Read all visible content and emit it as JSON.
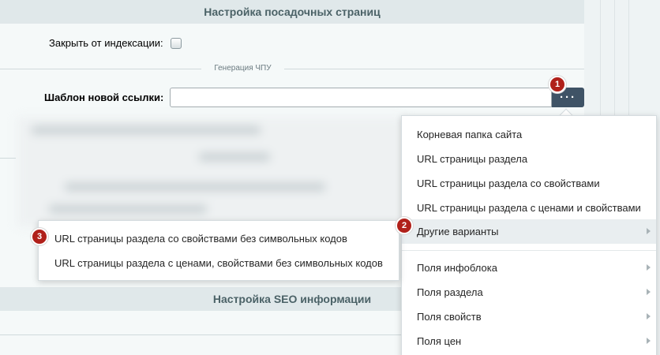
{
  "landing_section": {
    "title": "Настройка посадочных страниц",
    "noindex_label": "Закрыть от индексации:",
    "noindex_checked": false,
    "slug_group_label": "Генерация ЧПУ",
    "template_label": "Шаблон новой ссылки:",
    "template_value": "",
    "template_placeholder": "",
    "menu_button_label": "···"
  },
  "seo_section": {
    "title": "Настройка SEO информации"
  },
  "badges": [
    "1",
    "2",
    "3"
  ],
  "dropdown_menu": {
    "items": [
      {
        "label": "Корневая папка сайта",
        "has_submenu": false
      },
      {
        "label": "URL страницы раздела",
        "has_submenu": false
      },
      {
        "label": "URL страницы раздела со свойствами",
        "has_submenu": false
      },
      {
        "label": "URL страницы раздела с ценами и свойствами",
        "has_submenu": false
      },
      {
        "label": "Другие варианты",
        "has_submenu": true,
        "highlighted": true
      },
      {
        "label": "Поля инфоблока",
        "has_submenu": true
      },
      {
        "label": "Поля раздела",
        "has_submenu": true
      },
      {
        "label": "Поля свойств",
        "has_submenu": true
      },
      {
        "label": "Поля цен",
        "has_submenu": true
      }
    ]
  },
  "submenu": {
    "items": [
      {
        "label": "URL страницы раздела со свойствами без символьных кодов"
      },
      {
        "label": "URL страницы раздела с ценами, свойствами без символьных кодов"
      }
    ]
  },
  "colors": {
    "header_bg": "#e0e8ea",
    "button_bg": "#3f5366",
    "badge": "#b0201a",
    "highlight": "#e9eef0"
  }
}
